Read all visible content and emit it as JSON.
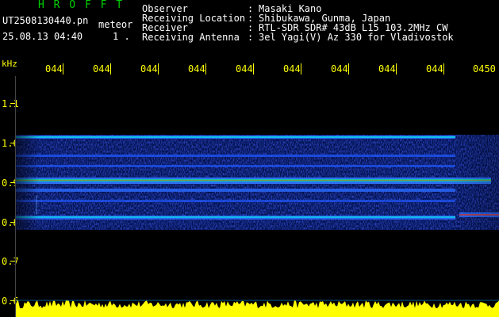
{
  "header": {
    "app_title": "H R O F F T",
    "file_name": "UT2508130440.pn",
    "meteor_label": "meteor",
    "datetime": "25.08.13 04:40",
    "count": "1 ."
  },
  "station_info": [
    {
      "label": "Observer",
      "value": "Masaki Kano"
    },
    {
      "label": "Receiving Location",
      "value": "Shibukawa, Gunma, Japan"
    },
    {
      "label": "Receiver",
      "value": "RTL-SDR SDR# 43dB L15 103.2MHz CW"
    },
    {
      "label": "Receiving Antenna",
      "value": "3el Yagi(V) Az 330 for Vladivostok"
    }
  ],
  "separator": ":",
  "time_axis": {
    "labels": [
      "044",
      "044",
      "044",
      "044",
      "044",
      "044",
      "044",
      "044",
      "044",
      "0450"
    ]
  },
  "freq_axis": {
    "unit": "kHz",
    "labels": [
      "1.1",
      "1.0",
      "0.9",
      "0.8",
      "0.7",
      "0.6"
    ]
  },
  "colors": {
    "text": "#ffffff",
    "title": "#00d000",
    "axis": "#ffff00",
    "background": "#000000"
  }
}
